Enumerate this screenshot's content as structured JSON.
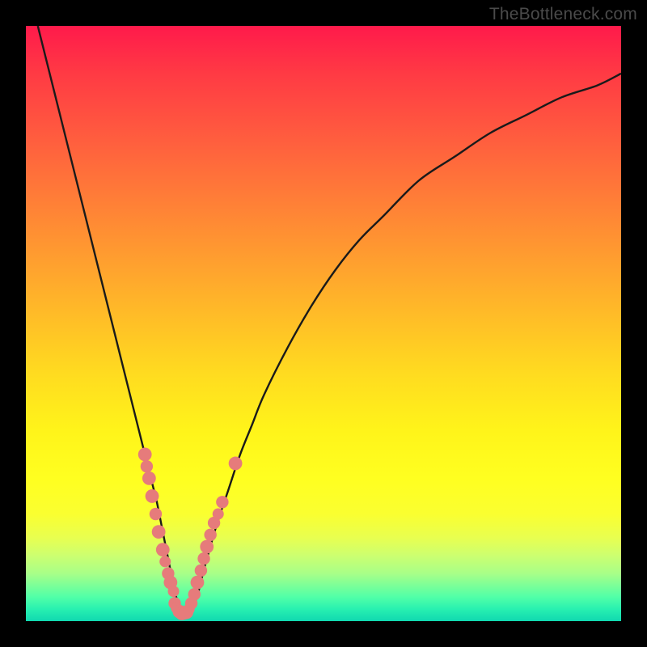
{
  "watermark": "TheBottleneck.com",
  "colors": {
    "frame": "#000000",
    "curve_stroke": "#1a1a1a",
    "marker_fill": "#e67b7b",
    "marker_stroke": "#d86b6b"
  },
  "chart_data": {
    "type": "line",
    "title": "",
    "xlabel": "",
    "ylabel": "",
    "xlim": [
      0,
      100
    ],
    "ylim": [
      0,
      100
    ],
    "axes_visible": false,
    "grid": false,
    "series": [
      {
        "name": "bottleneck-curve",
        "x": [
          2,
          4,
          6,
          8,
          10,
          12,
          14,
          16,
          18,
          20,
          21,
          22,
          23,
          24,
          25,
          26,
          27,
          28,
          29,
          30,
          32,
          34,
          36,
          38,
          40,
          44,
          48,
          52,
          56,
          60,
          66,
          72,
          78,
          84,
          90,
          96,
          100
        ],
        "y": [
          100,
          92,
          84,
          76,
          68,
          60,
          52,
          44,
          36,
          28,
          24,
          20,
          15,
          10,
          5,
          2,
          1,
          2,
          5,
          9,
          16,
          22,
          28,
          33,
          38,
          46,
          53,
          59,
          64,
          68,
          74,
          78,
          82,
          85,
          88,
          90,
          92
        ]
      }
    ],
    "markers": [
      {
        "x": 20.0,
        "y": 28,
        "r": 1.2
      },
      {
        "x": 20.3,
        "y": 26,
        "r": 1.1
      },
      {
        "x": 20.7,
        "y": 24,
        "r": 1.2
      },
      {
        "x": 21.2,
        "y": 21,
        "r": 1.2
      },
      {
        "x": 21.8,
        "y": 18,
        "r": 1.1
      },
      {
        "x": 22.3,
        "y": 15,
        "r": 1.2
      },
      {
        "x": 23.0,
        "y": 12,
        "r": 1.2
      },
      {
        "x": 23.4,
        "y": 10,
        "r": 1.0
      },
      {
        "x": 23.9,
        "y": 8,
        "r": 1.1
      },
      {
        "x": 24.3,
        "y": 6.5,
        "r": 1.2
      },
      {
        "x": 24.8,
        "y": 5,
        "r": 1.0
      },
      {
        "x": 25.0,
        "y": 3,
        "r": 1.1
      },
      {
        "x": 25.3,
        "y": 2.2,
        "r": 1.0
      },
      {
        "x": 25.8,
        "y": 1.6,
        "r": 1.2
      },
      {
        "x": 26.2,
        "y": 1.3,
        "r": 1.2
      },
      {
        "x": 26.6,
        "y": 1.3,
        "r": 1.1
      },
      {
        "x": 27.0,
        "y": 1.5,
        "r": 1.2
      },
      {
        "x": 27.4,
        "y": 2.0,
        "r": 1.0
      },
      {
        "x": 27.8,
        "y": 3.0,
        "r": 1.1
      },
      {
        "x": 28.3,
        "y": 4.5,
        "r": 1.1
      },
      {
        "x": 28.8,
        "y": 6.5,
        "r": 1.2
      },
      {
        "x": 29.4,
        "y": 8.5,
        "r": 1.1
      },
      {
        "x": 29.9,
        "y": 10.5,
        "r": 1.1
      },
      {
        "x": 30.4,
        "y": 12.5,
        "r": 1.2
      },
      {
        "x": 31.0,
        "y": 14.5,
        "r": 1.1
      },
      {
        "x": 31.6,
        "y": 16.5,
        "r": 1.1
      },
      {
        "x": 32.3,
        "y": 18.0,
        "r": 1.0
      },
      {
        "x": 33.0,
        "y": 20.0,
        "r": 1.1
      },
      {
        "x": 35.2,
        "y": 26.5,
        "r": 1.2
      }
    ]
  }
}
